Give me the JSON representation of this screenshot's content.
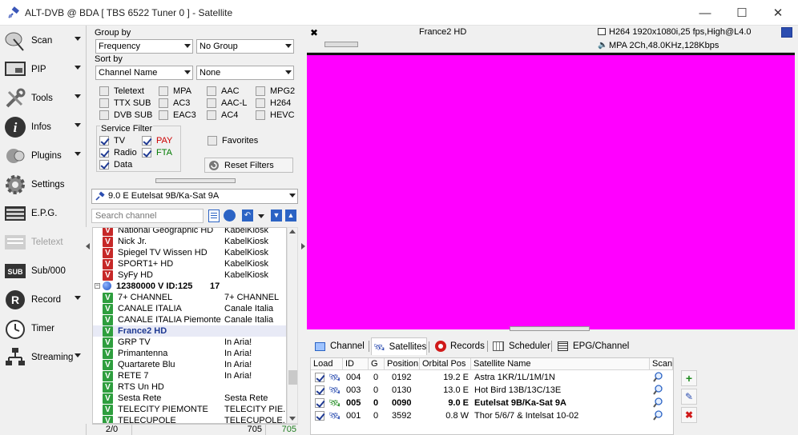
{
  "window": {
    "title": "ALT-DVB @ BDA [ TBS 6522 Tuner 0 ] - Satellite",
    "minimize": "—",
    "maximize": "☐",
    "close": "✕"
  },
  "sidebar": [
    {
      "label": "Scan",
      "icon": "satellite-dish-icon",
      "arrow": true
    },
    {
      "label": "PIP",
      "icon": "pip-icon",
      "arrow": true
    },
    {
      "label": "Tools",
      "icon": "tools-icon",
      "arrow": true
    },
    {
      "label": "Infos",
      "icon": "info-icon",
      "arrow": true
    },
    {
      "label": "Plugins",
      "icon": "plugins-icon",
      "arrow": true
    },
    {
      "label": "Settings",
      "icon": "gear-icon",
      "arrow": false
    },
    {
      "label": "E.P.G.",
      "icon": "epg-icon",
      "arrow": false
    },
    {
      "label": "Teletext",
      "icon": "teletext-icon",
      "arrow": false
    },
    {
      "label": "Sub/000",
      "icon": "subtitle-icon",
      "arrow": false
    },
    {
      "label": "Record",
      "icon": "record-icon",
      "arrow": true
    },
    {
      "label": "Timer",
      "icon": "timer-icon",
      "arrow": false
    },
    {
      "label": "Streaming",
      "icon": "streaming-icon",
      "arrow": true
    }
  ],
  "filters": {
    "group_by_label": "Group by",
    "group_by_value": "Frequency",
    "group_by_second": "No Group",
    "sort_by_label": "Sort by",
    "sort_by_value": "Channel Name",
    "sort_by_second": "None",
    "checkboxes": [
      {
        "label": "Teletext",
        "checked": false
      },
      {
        "label": "MPA",
        "checked": false
      },
      {
        "label": "AAC",
        "checked": false
      },
      {
        "label": "MPG2",
        "checked": false
      },
      {
        "label": "TTX SUB",
        "checked": false
      },
      {
        "label": "AC3",
        "checked": false
      },
      {
        "label": "AAC-L",
        "checked": false
      },
      {
        "label": "H264",
        "checked": false
      },
      {
        "label": "DVB SUB",
        "checked": false
      },
      {
        "label": "EAC3",
        "checked": false
      },
      {
        "label": "AC4",
        "checked": false
      },
      {
        "label": "HEVC",
        "checked": false
      }
    ],
    "service_filter_label": "Service Filter",
    "service": [
      {
        "label": "TV",
        "checked": true,
        "color": "#000000"
      },
      {
        "label": "PAY",
        "checked": true,
        "color": "#cc0000"
      },
      {
        "label": "Radio",
        "checked": true,
        "color": "#000000"
      },
      {
        "label": "FTA",
        "checked": true,
        "color": "#007a00"
      },
      {
        "label": "Data",
        "checked": true,
        "color": "#000000"
      }
    ],
    "favorites_label": "Favorites",
    "reset_label": "Reset Filters"
  },
  "satellite_select": "9.0 E Eutelsat 9B/Ka-Sat 9A",
  "search": {
    "placeholder": "Search channel"
  },
  "channels": [
    {
      "name": "National Geographic HD",
      "provider": "KabelKiosk",
      "type": "pay",
      "selected": false
    },
    {
      "name": "Nick Jr.",
      "provider": "KabelKiosk",
      "type": "pay",
      "selected": false
    },
    {
      "name": "Spiegel TV Wissen HD",
      "provider": "KabelKiosk",
      "type": "pay",
      "selected": false
    },
    {
      "name": "SPORT1+ HD",
      "provider": "KabelKiosk",
      "type": "pay",
      "selected": false
    },
    {
      "name": "SyFy HD",
      "provider": "KabelKiosk",
      "type": "pay",
      "selected": false
    },
    {
      "name": "12380000 V ID:125",
      "provider": "17",
      "type": "group",
      "selected": false
    },
    {
      "name": "7+ CHANNEL",
      "provider": "7+ CHANNEL",
      "type": "fta",
      "selected": false
    },
    {
      "name": "CANALE ITALIA",
      "provider": "Canale Italia",
      "type": "fta",
      "selected": false
    },
    {
      "name": "CANALE ITALIA Piemonte",
      "provider": "Canale Italia",
      "type": "fta",
      "selected": false
    },
    {
      "name": "France2 HD",
      "provider": "",
      "type": "fta",
      "selected": true
    },
    {
      "name": "GRP TV",
      "provider": "In Aria!",
      "type": "fta",
      "selected": false
    },
    {
      "name": "Primantenna",
      "provider": "In Aria!",
      "type": "fta",
      "selected": false
    },
    {
      "name": "Quartarete Blu",
      "provider": "In Aria!",
      "type": "fta",
      "selected": false
    },
    {
      "name": "RETE 7",
      "provider": "In Aria!",
      "type": "fta",
      "selected": false
    },
    {
      "name": "RTS Un HD",
      "provider": "",
      "type": "fta",
      "selected": false
    },
    {
      "name": "Sesta Rete",
      "provider": "Sesta Rete",
      "type": "fta",
      "selected": false
    },
    {
      "name": "TELECITY PIEMONTE",
      "provider": "TELECITY PIE...",
      "type": "fta",
      "selected": false
    },
    {
      "name": "TELECUPOLE",
      "provider": "TELECUPOLE...",
      "type": "fta",
      "selected": false
    }
  ],
  "statusbar": {
    "left": "2/0",
    "middle": "705",
    "right": "705"
  },
  "video": {
    "channel_name": "France2 HD",
    "video_info": "H264 1920x1080i,25 fps,High@L4.0",
    "audio_info": "MPA 2Ch,48.0KHz,128Kbps",
    "close": "✖"
  },
  "tabs": [
    {
      "label": "Channel",
      "icon": "channel-icon",
      "active": false
    },
    {
      "label": "Satellites",
      "icon": "satellite-icon",
      "active": true
    },
    {
      "label": "Records",
      "icon": "record-icon",
      "active": false
    },
    {
      "label": "Scheduler",
      "icon": "scheduler-icon",
      "active": false
    },
    {
      "label": "EPG/Channel",
      "icon": "epg-channel-icon",
      "active": false
    }
  ],
  "satellites": {
    "headers": [
      "Load",
      "ID",
      "G",
      "Position",
      "Orbital Pos",
      "Satellite Name",
      "Scan"
    ],
    "rows": [
      {
        "id": "004",
        "g": "0",
        "position": "0192",
        "orbital": "19.2 E",
        "name": "Astra 1KR/1L/1M/1N",
        "bold": false
      },
      {
        "id": "003",
        "g": "0",
        "position": "0130",
        "orbital": "13.0 E",
        "name": "Hot Bird 13B/13C/13E",
        "bold": false
      },
      {
        "id": "005",
        "g": "0",
        "position": "0090",
        "orbital": "9.0 E",
        "name": "Eutelsat 9B/Ka-Sat 9A",
        "bold": true
      },
      {
        "id": "001",
        "g": "0",
        "position": "3592",
        "orbital": "0.8 W",
        "name": "Thor 5/6/7 & Intelsat 10-02",
        "bold": false
      }
    ]
  },
  "colors": {
    "video_background": "#ff00ff",
    "pay_badge": "#c62828",
    "fta_badge": "#2e9e3e",
    "selected_row": "#e8eaf6"
  }
}
